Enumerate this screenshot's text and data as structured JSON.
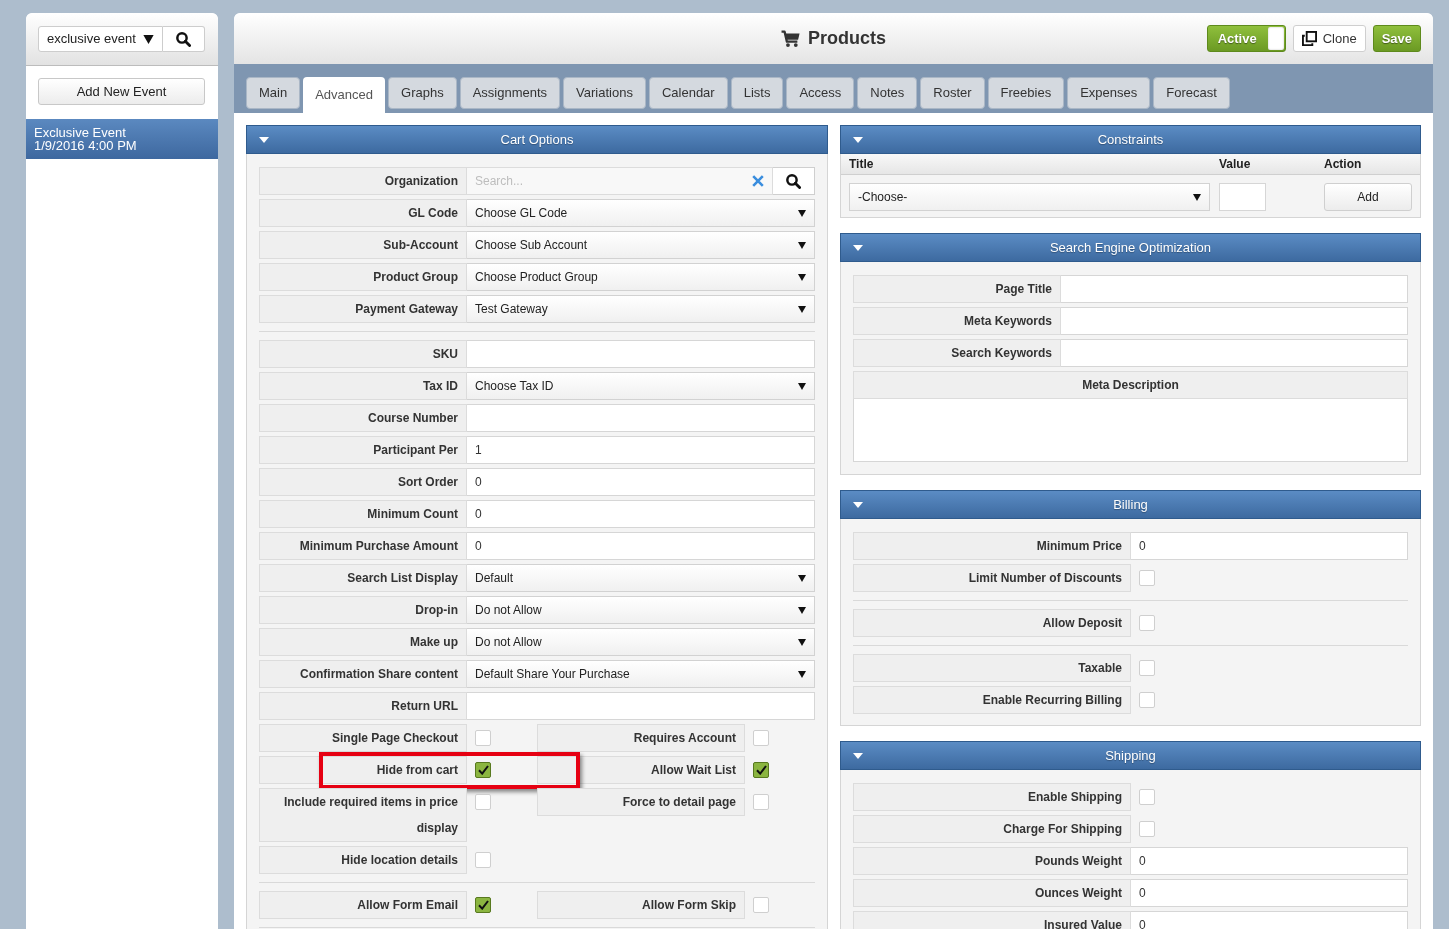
{
  "sidebar": {
    "search": {
      "value": "exclusive event"
    },
    "add_button": "Add New Event",
    "events": [
      {
        "name": "Exclusive Event",
        "date": "1/9/2016 4:00 PM",
        "selected": true
      }
    ]
  },
  "header": {
    "title": "Products",
    "active_toggle": {
      "label": "Active",
      "on": true
    },
    "buttons": [
      {
        "kind": "clone",
        "label": "Clone"
      },
      {
        "kind": "save",
        "label": "Save"
      }
    ]
  },
  "tabs": [
    {
      "label": "Main",
      "selected": false
    },
    {
      "label": "Advanced",
      "selected": true
    },
    {
      "label": "Graphs",
      "selected": false
    },
    {
      "label": "Assignments",
      "selected": false
    },
    {
      "label": "Variations",
      "selected": false
    },
    {
      "label": "Calendar",
      "selected": false
    },
    {
      "label": "Lists",
      "selected": false
    },
    {
      "label": "Access",
      "selected": false
    },
    {
      "label": "Notes",
      "selected": false
    },
    {
      "label": "Roster",
      "selected": false
    },
    {
      "label": "Freebies",
      "selected": false
    },
    {
      "label": "Expenses",
      "selected": false
    },
    {
      "label": "Forecast",
      "selected": false
    }
  ],
  "cart_options": {
    "title": "Cart Options",
    "groups": [
      {
        "rows": [
          {
            "kind": "search",
            "label": "Organization",
            "placeholder": "Search..."
          },
          {
            "kind": "select",
            "label": "GL Code",
            "value": "Choose GL Code"
          },
          {
            "kind": "select",
            "label": "Sub-Account",
            "value": "Choose Sub Account"
          },
          {
            "kind": "select",
            "label": "Product Group",
            "value": "Choose Product Group"
          },
          {
            "kind": "select",
            "label": "Payment Gateway",
            "value": "Test Gateway"
          }
        ]
      },
      {
        "rows": [
          {
            "kind": "text",
            "label": "SKU"
          },
          {
            "kind": "select",
            "label": "Tax ID",
            "value": "Choose Tax ID"
          },
          {
            "kind": "text",
            "label": "Course Number"
          },
          {
            "kind": "text",
            "label": "Participant Per",
            "value": "1"
          },
          {
            "kind": "text",
            "label": "Sort Order",
            "value": "0"
          },
          {
            "kind": "text",
            "label": "Minimum Count",
            "value": "0"
          },
          {
            "kind": "text",
            "label": "Minimum Purchase Amount",
            "value": "0"
          },
          {
            "kind": "select",
            "label": "Search List Display",
            "value": "Default"
          },
          {
            "kind": "select",
            "label": "Drop-in",
            "value": "Do not Allow"
          },
          {
            "kind": "select",
            "label": "Make up",
            "value": "Do not Allow"
          },
          {
            "kind": "select",
            "label": "Confirmation Share content",
            "value": "Default Share Your Purchase"
          },
          {
            "kind": "text",
            "label": "Return URL"
          },
          {
            "kind": "checks",
            "highlighted": false,
            "items": [
              {
                "label": "Single Page Checkout",
                "checked": false
              },
              {
                "label": "Requires Account",
                "checked": false
              }
            ]
          },
          {
            "kind": "checks",
            "highlighted": true,
            "items": [
              {
                "label": "Hide from cart",
                "checked": true
              },
              {
                "label": "Allow Wait List",
                "checked": true
              }
            ]
          },
          {
            "kind": "checks",
            "highlighted": false,
            "items": [
              {
                "label": "Include required items in price display",
                "checked": false
              },
              {
                "label": "Force to detail page",
                "checked": false
              }
            ]
          },
          {
            "kind": "checks",
            "highlighted": false,
            "items": [
              {
                "label": "Hide location details",
                "checked": false
              }
            ]
          }
        ]
      },
      {
        "rows": [
          {
            "kind": "checks",
            "highlighted": false,
            "items": [
              {
                "label": "Allow Form Email",
                "checked": true
              },
              {
                "label": "Allow Form Skip",
                "checked": false
              }
            ]
          }
        ]
      }
    ]
  },
  "constraints": {
    "title": "Constraints",
    "columns": [
      "Title",
      "Value",
      "Action"
    ],
    "choice": "-Choose-",
    "add_button": "Add"
  },
  "seo": {
    "title": "Search Engine Optimization",
    "rows": [
      {
        "kind": "text",
        "label": "Page Title"
      },
      {
        "kind": "text",
        "label": "Meta Keywords"
      },
      {
        "kind": "text",
        "label": "Search Keywords"
      }
    ],
    "description_label": "Meta Description"
  },
  "billing": {
    "title": "Billing",
    "groups": [
      {
        "rows": [
          {
            "kind": "text",
            "label": "Minimum Price",
            "value": "0"
          },
          {
            "kind": "checks",
            "items": [
              {
                "label": "Limit Number of Discounts",
                "checked": false
              }
            ]
          }
        ]
      },
      {
        "rows": [
          {
            "kind": "checks",
            "items": [
              {
                "label": "Allow Deposit",
                "checked": false
              }
            ]
          }
        ]
      },
      {
        "rows": [
          {
            "kind": "checks",
            "items": [
              {
                "label": "Taxable",
                "checked": false
              }
            ]
          },
          {
            "kind": "checks",
            "items": [
              {
                "label": "Enable Recurring Billing",
                "checked": false
              }
            ]
          }
        ]
      }
    ]
  },
  "shipping": {
    "title": "Shipping",
    "groups": [
      {
        "rows": [
          {
            "kind": "checks",
            "items": [
              {
                "label": "Enable Shipping",
                "checked": false
              }
            ]
          },
          {
            "kind": "checks",
            "items": [
              {
                "label": "Charge For Shipping",
                "checked": false
              }
            ]
          },
          {
            "kind": "text",
            "label": "Pounds Weight",
            "value": "0"
          },
          {
            "kind": "text",
            "label": "Ounces Weight",
            "value": "0"
          },
          {
            "kind": "text",
            "label": "Insured Value",
            "value": "0"
          }
        ]
      }
    ]
  }
}
